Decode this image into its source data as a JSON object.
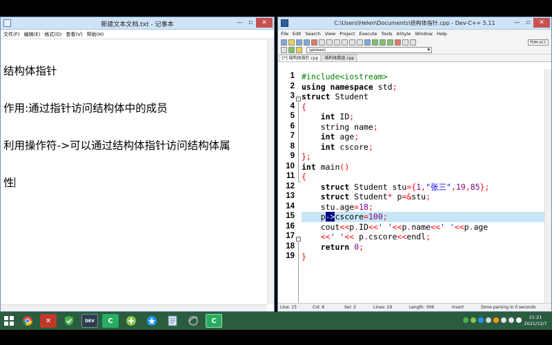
{
  "notepad": {
    "title": "新建文本文档.txt - 记事本",
    "menu": [
      "文件(F)",
      "编辑(E)",
      "格式(O)",
      "查看(V)",
      "帮助(H)"
    ],
    "lines": [
      "结构体指针",
      "作用:通过指针访问结构体中的成员",
      "利用操作符->可以通过结构体指针访问结构体属",
      "性"
    ]
  },
  "devcpp": {
    "title": "C:\\Users\\Helen\\Documents\\结构体指针.cpp - Dev-C++ 5.11",
    "menu": [
      "File",
      "Edit",
      "Search",
      "View",
      "Project",
      "Execute",
      "Tools",
      "AStyle",
      "Window",
      "Help"
    ],
    "compiler_combo": "TDM-GCC",
    "globals_combo": "(globals)",
    "tabs": [
      "[*] 结构体指针.cpp",
      "结构体数组.cpp"
    ],
    "line_numbers": [
      "1",
      "2",
      "3",
      "4",
      "5",
      "6",
      "7",
      "8",
      "9",
      "10",
      "11",
      "12",
      "13",
      "14",
      "15",
      "16",
      "17",
      "18",
      "19"
    ],
    "current_line": 15,
    "status": {
      "line": "Line:  15",
      "col": "Col:   6",
      "sel": "Sel:   2",
      "lines": "Lines:   19",
      "length": "Length:   306",
      "mode": "Insert",
      "message": "Done parsing in 0 seconds"
    }
  },
  "taskbar": {
    "apps": [
      "windows-start",
      "chrome",
      "xmind",
      "shield",
      "devcpp",
      "camtasia",
      "app-green",
      "app-blue",
      "notepad",
      "ie",
      "camtasia2"
    ],
    "clock_time": "21:21",
    "clock_date": "2021/12/7"
  }
}
